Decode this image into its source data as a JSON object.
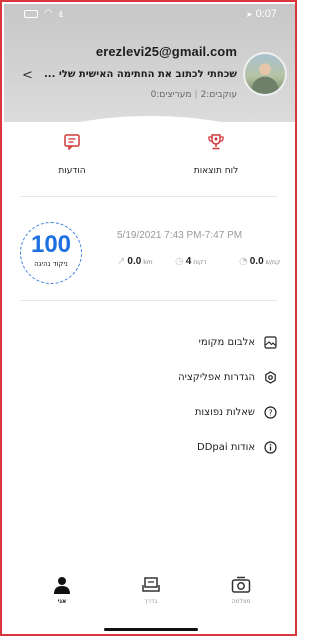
{
  "status_bar": {
    "time": "0:07",
    "icons": [
      "battery-icon",
      "wifi-icon",
      "signal-icon",
      "location-icon"
    ]
  },
  "profile": {
    "email": "erezlevi25@gmail.com",
    "signature": "שכחתי לכתוב את החתימה האישית שלי ...",
    "following_label": "עוקבים:2",
    "followers_label": "מעריצים:0",
    "separator": "|"
  },
  "quick_actions": [
    {
      "label": "הודעות",
      "icon": "message-icon"
    },
    {
      "label": "לוח תוצאות",
      "icon": "trophy-icon"
    }
  ],
  "trip": {
    "score": "100",
    "score_label": "ניקוד נהיגה",
    "datetime": "5/19/2021 7:43 PM-7:47 PM",
    "distance_value": "0.0",
    "distance_unit": "km",
    "duration_value": "4",
    "duration_unit": "דקות",
    "speed_value": "0.0",
    "speed_unit": "קמ/ש"
  },
  "menu": [
    {
      "label": "אלבום מקומי",
      "icon": "album-icon"
    },
    {
      "label": "הגדרות אפליקציה",
      "icon": "settings-icon"
    },
    {
      "label": "שאלות נפוצות",
      "icon": "faq-icon"
    },
    {
      "label": "אודות DDpai",
      "icon": "info-icon"
    }
  ],
  "bottom_nav": [
    {
      "label": "אני",
      "icon": "person-icon",
      "active": true
    },
    {
      "label": "בדרך",
      "icon": "car-icon",
      "active": false
    },
    {
      "label": "מצלמה",
      "icon": "camera-icon",
      "active": false
    }
  ],
  "colors": {
    "accent": "#1e6fe0",
    "frame_border": "#d9363e",
    "header_bg": "#cfcfcf"
  }
}
